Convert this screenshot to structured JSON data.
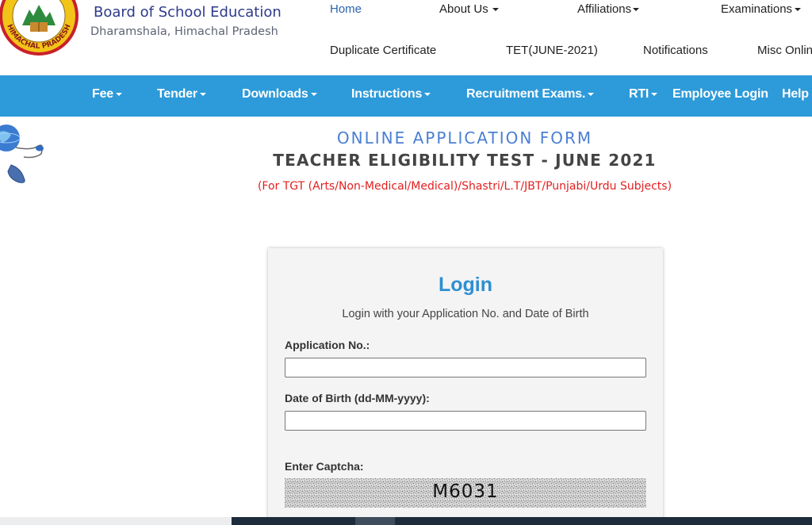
{
  "brand": {
    "title": "Board of School Education",
    "location": "Dharamshala, Himachal Pradesh",
    "seal_text": "HIMACHAL PRADESH"
  },
  "top_nav": [
    {
      "label": "Home",
      "has_menu": false
    },
    {
      "label": "About Us",
      "has_menu": true
    },
    {
      "label": "Affiliations",
      "has_menu": true
    },
    {
      "label": "Examinations",
      "has_menu": true
    },
    {
      "label": "Duplicate Certificate",
      "has_menu": false
    },
    {
      "label": "TET(JUNE-2021)",
      "has_menu": false
    },
    {
      "label": "Notifications",
      "has_menu": false
    },
    {
      "label": "Misc Onlin",
      "has_menu": false
    }
  ],
  "blue_nav": [
    {
      "label": "Fee",
      "has_menu": true
    },
    {
      "label": "Tender",
      "has_menu": true
    },
    {
      "label": "Downloads",
      "has_menu": true
    },
    {
      "label": "Instructions",
      "has_menu": true
    },
    {
      "label": "Recruitment Exams.",
      "has_menu": true
    },
    {
      "label": "RTI",
      "has_menu": true
    },
    {
      "label": "Employee Login",
      "has_menu": false
    },
    {
      "label": "Help",
      "has_menu": false
    }
  ],
  "headings": {
    "form_title": "ONLINE APPLICATION FORM",
    "exam_title": "TEACHER ELIGIBILITY TEST - JUNE 2021",
    "subjects_note": "(For TGT (Arts/Non-Medical/Medical)/Shastri/L.T/JBT/Punjabi/Urdu Subjects)"
  },
  "login": {
    "title": "Login",
    "subtitle": "Login with your Application No. and Date of Birth",
    "application_label": "Application No.:",
    "application_value": "",
    "dob_label": "Date of Birth (dd-MM-yyyy):",
    "dob_value": "",
    "captcha_label": "Enter Captcha:",
    "captcha_text": "M6031"
  },
  "colors": {
    "nav_bar": "#2d9ad9",
    "brand_title": "#2d3a8c",
    "form_title": "#4a7fd4",
    "login_title": "#2d8fd1",
    "subjects_note": "#e32020",
    "active_nav": "#2c64b0"
  },
  "icons": [
    "school-seal-logo",
    "globe-mouse-icon",
    "caret-down-icon"
  ]
}
